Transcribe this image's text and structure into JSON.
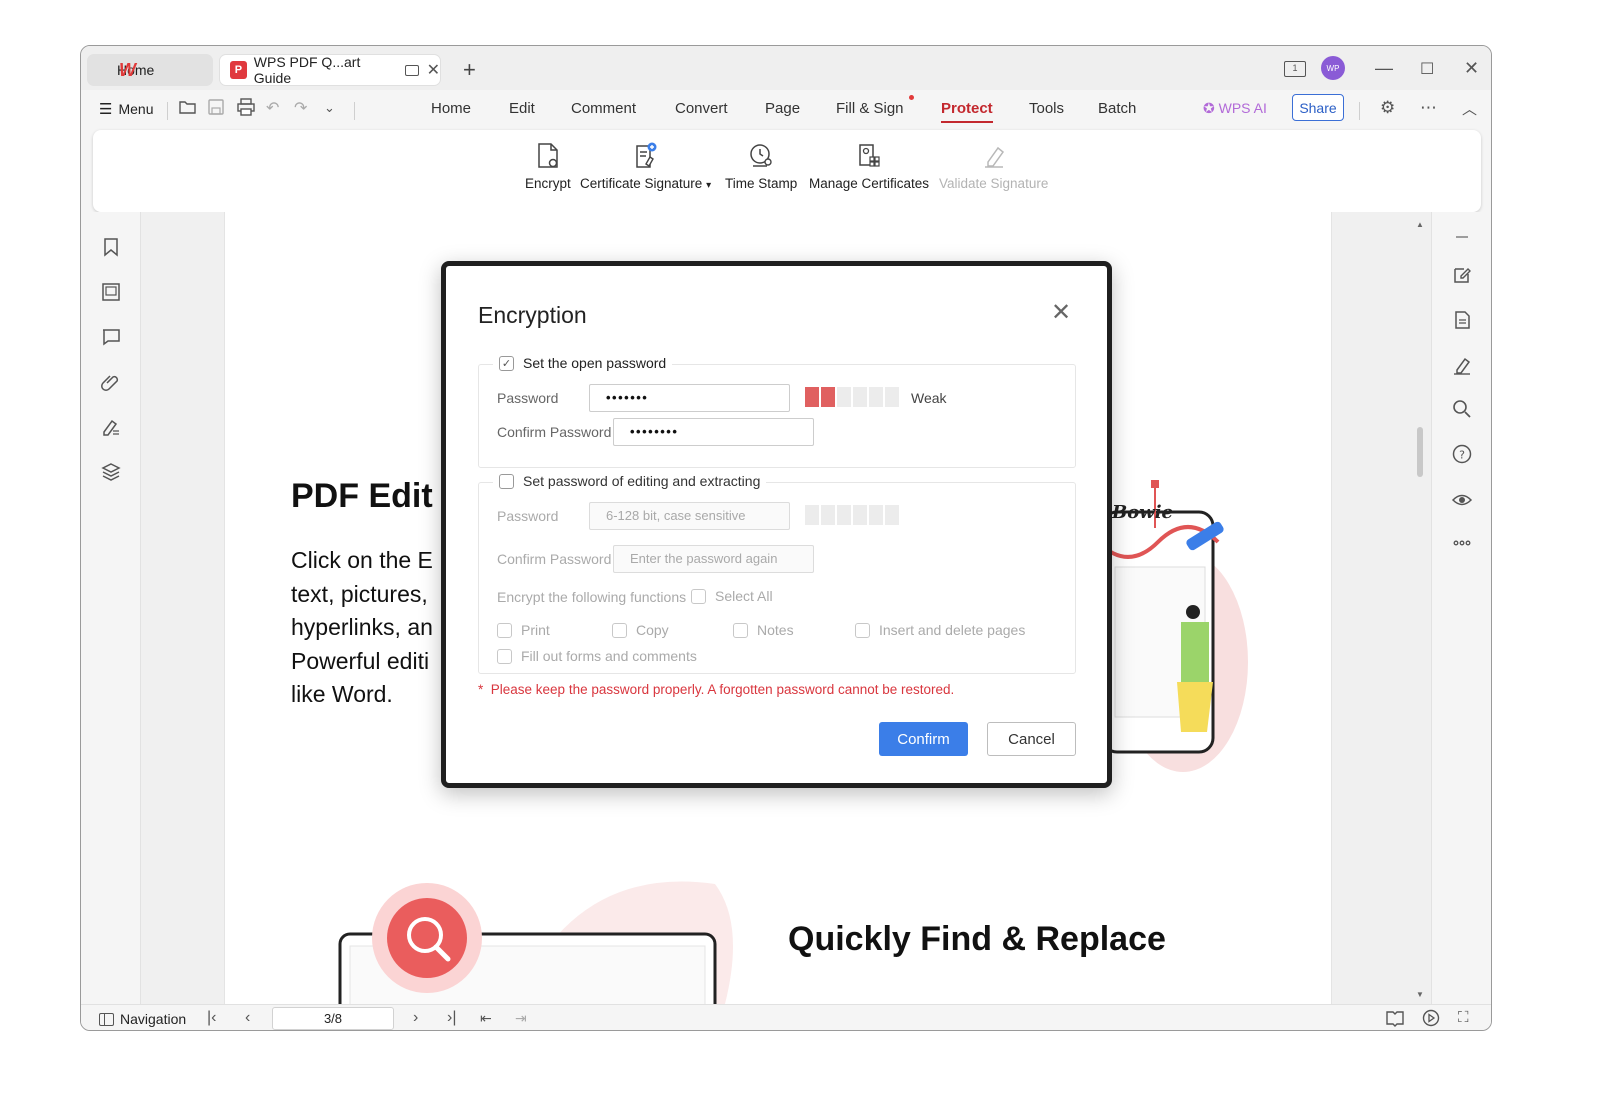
{
  "tabs": {
    "home_label": "Home",
    "doc_label": "WPS PDF Q...art Guide"
  },
  "titlebar": {
    "avatar_initials": "WP",
    "dual_view_label": "1"
  },
  "menubar": {
    "menu_label": "Menu",
    "tabs": [
      "Home",
      "Edit",
      "Comment",
      "Convert",
      "Page",
      "Fill & Sign",
      "Protect",
      "Tools",
      "Batch"
    ],
    "active_tab": "Protect",
    "wps_ai_label": "WPS AI",
    "share_label": "Share"
  },
  "ribbon": {
    "encrypt": "Encrypt",
    "certificate_signature": "Certificate Signature",
    "time_stamp": "Time Stamp",
    "manage_certificates": "Manage Certificates",
    "validate_signature": "Validate Signature"
  },
  "document": {
    "heading": "PDF Edit",
    "body": "Click on the E\ntext, pictures,\nhyperlinks, an\nPowerful editi\nlike Word.",
    "heading2": "Quickly Find & Replace",
    "illustration_text": "Bowie"
  },
  "dialog": {
    "title": "Encryption",
    "open_password": {
      "checkbox_label": "Set the open password",
      "checked": true,
      "password_label": "Password",
      "password_value": "•••••••",
      "confirm_label": "Confirm Password",
      "confirm_value": "••••••••",
      "strength_label": "Weak",
      "strength_level": 2,
      "strength_max": 6
    },
    "edit_password": {
      "checkbox_label": "Set password of editing and extracting",
      "checked": false,
      "password_label": "Password",
      "password_placeholder": "6-128 bit, case sensitive",
      "confirm_label": "Confirm Password",
      "confirm_placeholder": "Enter the password again",
      "functions_label": "Encrypt the following functions",
      "select_all": "Select All",
      "options": [
        "Print",
        "Copy",
        "Notes",
        "Insert and delete pages",
        "Fill out forms and comments"
      ]
    },
    "warning": "Please keep the password properly. A forgotten password cannot be restored.",
    "confirm_button": "Confirm",
    "cancel_button": "Cancel"
  },
  "statusbar": {
    "navigation_label": "Navigation",
    "page_indicator": "3/8"
  },
  "colors": {
    "accent_red": "#c3282e",
    "primary_blue": "#3b7ee8",
    "strength_red": "#e06060",
    "warning_red": "#d9363e"
  }
}
